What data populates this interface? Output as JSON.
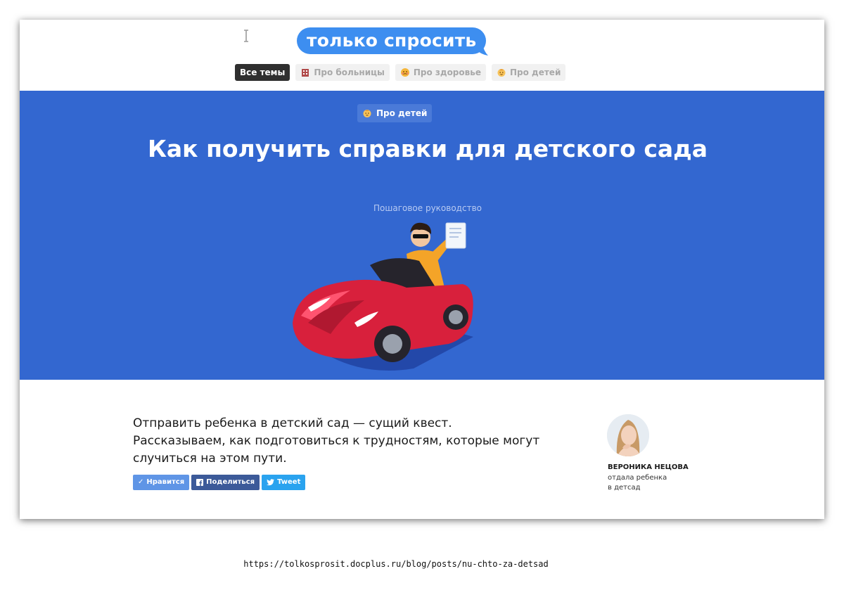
{
  "colors": {
    "logo_blue": "#3d8ef0",
    "hero_blue": "#3367d0",
    "nav_active_bg": "#2f2f2f",
    "like_blue": "#5f95e6",
    "facebook_blue": "#3c5a99",
    "twitter_blue": "#2aa3ef"
  },
  "header": {
    "logo_text": "только спросить",
    "nav": [
      {
        "label": "Все темы",
        "icon": null,
        "active": true
      },
      {
        "label": "Про больницы",
        "icon": "hospital-icon",
        "active": false
      },
      {
        "label": "Про здоровье",
        "icon": "sick-face-icon",
        "active": false
      },
      {
        "label": "Про детей",
        "icon": "baby-icon",
        "active": false
      }
    ]
  },
  "hero": {
    "badge": "Про детей",
    "badge_icon": "baby-icon",
    "title": "Как получить справки для детского сада",
    "subtitle": "Пошаговое руководство",
    "illustration": "man-in-red-toy-car-with-document"
  },
  "article": {
    "intro_line1": "Отправить ребенка в детский сад — сущий квест.",
    "intro_line2": "Рассказываем, как подготовиться к трудностям, которые могут случиться на этом пути."
  },
  "share": {
    "like": "Нравится",
    "facebook": "Поделиться",
    "twitter": "Tweet"
  },
  "author": {
    "name": "ВЕРОНИКА НЕЦОВА",
    "desc_line1": "отдала ребенка",
    "desc_line2": "в детсад"
  },
  "url": "https://tolkosprosit.docplus.ru/blog/posts/nu-chto-za-detsad"
}
